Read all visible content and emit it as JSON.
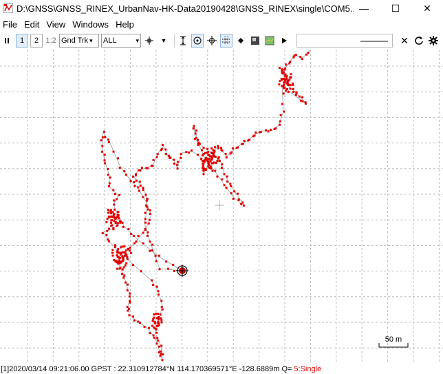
{
  "window": {
    "title": "D:\\GNSS\\GNSS_RINEX_UrbanNav-HK-Data20190428\\GNSS_RINEX\\single\\COM5...",
    "minimize_glyph": "—",
    "maximize_glyph": "☐",
    "close_glyph": "✕"
  },
  "menu": [
    "File",
    "Edit",
    "View",
    "Windows",
    "Help"
  ],
  "toolbar": {
    "btn1": "1",
    "btn2": "2",
    "btn12": "1:2",
    "plot_type": "Gnd Trk",
    "sat_filter": "ALL",
    "search_value": ""
  },
  "plot": {
    "scale_label": "50 m",
    "track_color": "#e00000",
    "line_color": "#9a9a9a",
    "grid_color": "#bcbcbc"
  },
  "status": {
    "index": "[1]",
    "datetime": "2020/03/14 09:21:06.00 GPST :",
    "lat": "22.310912784°N",
    "lon": "114.170369571°E",
    "height": "-128.6889m",
    "q_label": "Q=",
    "quality": "5:Single"
  }
}
